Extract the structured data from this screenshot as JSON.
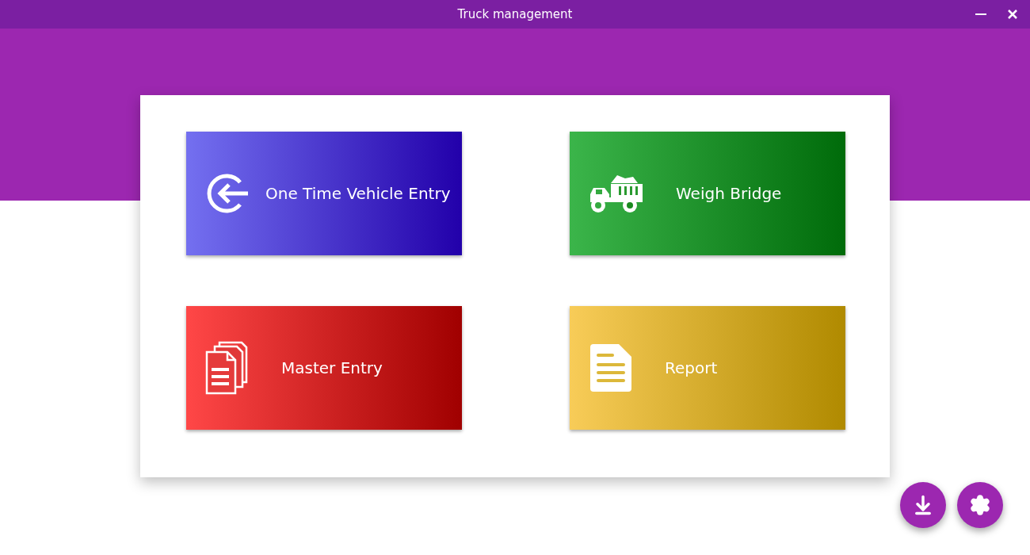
{
  "window": {
    "title": "Truck management"
  },
  "tiles": [
    {
      "kind": "entry",
      "label": "One Time Vehicle Entry"
    },
    {
      "kind": "weigh",
      "label": "Weigh Bridge"
    },
    {
      "kind": "master",
      "label": "Master Entry"
    },
    {
      "kind": "report",
      "label": "Report"
    }
  ]
}
